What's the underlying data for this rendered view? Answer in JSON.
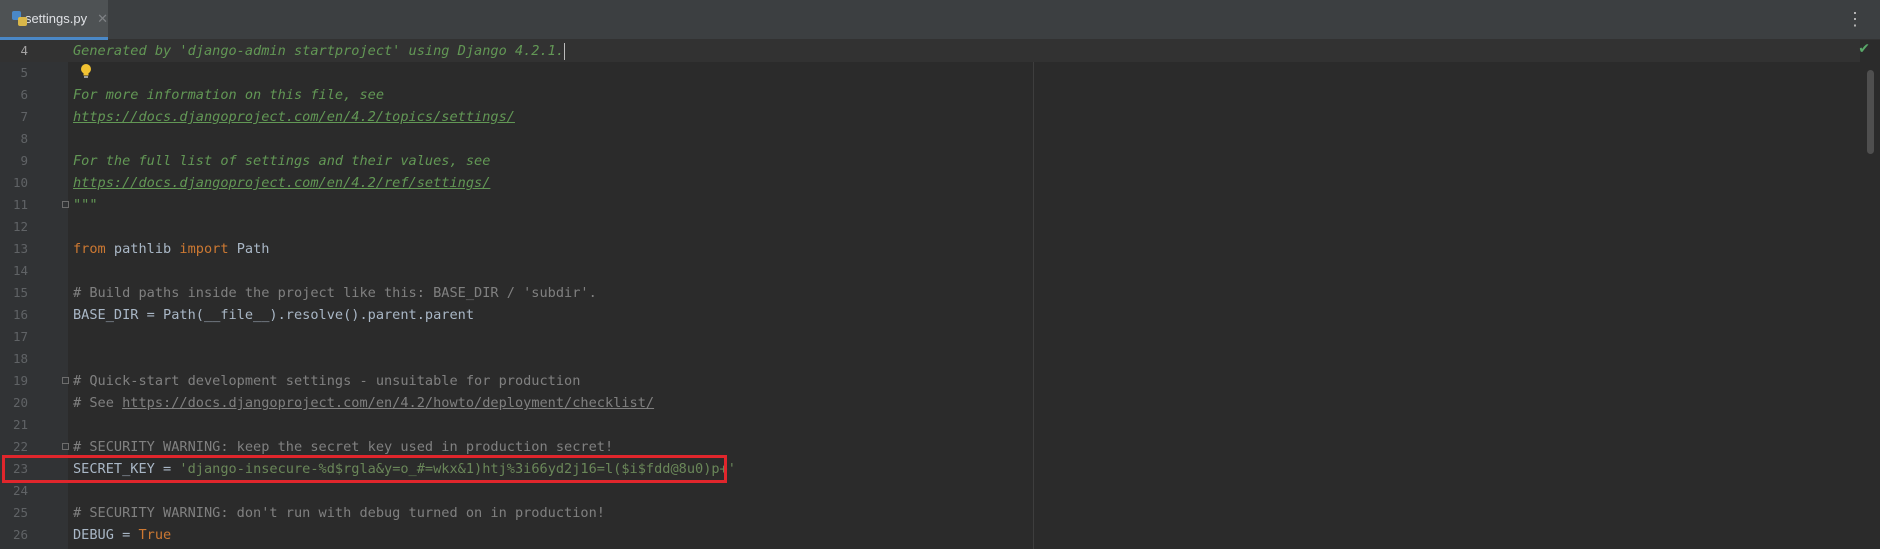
{
  "tab": {
    "filename": "settings.py",
    "close_glyph": "✕"
  },
  "menu_glyph": "⋮",
  "status": {
    "inspection_glyph": "✔"
  },
  "lines": [
    {
      "num": "4",
      "tokens": [
        {
          "t": "Generated by 'django-admin startproject' using Django 4.2.1.",
          "c": "doc"
        }
      ],
      "caret": true
    },
    {
      "num": "5",
      "tokens": []
    },
    {
      "num": "6",
      "tokens": [
        {
          "t": "For more information on this file, see",
          "c": "doc"
        }
      ]
    },
    {
      "num": "7",
      "tokens": [
        {
          "t": "https://docs.djangoproject.com/en/4.2/topics/settings/",
          "c": "doclink"
        }
      ]
    },
    {
      "num": "8",
      "tokens": []
    },
    {
      "num": "9",
      "tokens": [
        {
          "t": "For the full list of settings and their values, see",
          "c": "doc"
        }
      ]
    },
    {
      "num": "10",
      "tokens": [
        {
          "t": "https://docs.djangoproject.com/en/4.2/ref/settings/",
          "c": "doclink"
        }
      ]
    },
    {
      "num": "11",
      "tokens": [
        {
          "t": "\"\"\"",
          "c": "doc"
        }
      ]
    },
    {
      "num": "12",
      "tokens": []
    },
    {
      "num": "13",
      "tokens": [
        {
          "t": "from",
          "c": "kw"
        },
        {
          "t": " pathlib ",
          "c": "plain"
        },
        {
          "t": "import",
          "c": "kw"
        },
        {
          "t": " Path",
          "c": "plain"
        }
      ]
    },
    {
      "num": "14",
      "tokens": []
    },
    {
      "num": "15",
      "tokens": [
        {
          "t": "# Build paths inside the project like this: BASE_DIR / 'subdir'.",
          "c": "com"
        }
      ]
    },
    {
      "num": "16",
      "tokens": [
        {
          "t": "BASE_DIR = Path(__file__).resolve().parent.parent",
          "c": "plain"
        }
      ]
    },
    {
      "num": "17",
      "tokens": []
    },
    {
      "num": "18",
      "tokens": []
    },
    {
      "num": "19",
      "tokens": [
        {
          "t": "# Quick-start development settings - unsuitable for production",
          "c": "com"
        }
      ]
    },
    {
      "num": "20",
      "tokens": [
        {
          "t": "# See ",
          "c": "com"
        },
        {
          "t": "https://docs.djangoproject.com/en/4.2/howto/deployment/checklist/",
          "c": "comlink"
        }
      ]
    },
    {
      "num": "21",
      "tokens": []
    },
    {
      "num": "22",
      "tokens": [
        {
          "t": "# SECURITY WARNING: keep the secret key used in production secret!",
          "c": "com"
        }
      ]
    },
    {
      "num": "23",
      "tokens": [
        {
          "t": "SECRET_KEY = ",
          "c": "plain"
        },
        {
          "t": "'django-insecure-%d$rgla&y=o_#=wkx&1)htj%3i66yd2j16=l($i$fdd@8u0)p+'",
          "c": "str"
        }
      ]
    },
    {
      "num": "24",
      "tokens": []
    },
    {
      "num": "25",
      "tokens": [
        {
          "t": "# SECURITY WARNING: don't run with debug turned on in production!",
          "c": "com"
        }
      ]
    },
    {
      "num": "26",
      "tokens": [
        {
          "t": "DEBUG = ",
          "c": "plain"
        },
        {
          "t": "True",
          "c": "kw"
        }
      ]
    }
  ],
  "colors": {
    "background": "#2b2b2b",
    "docstring": "#629755",
    "keyword": "#cc7832",
    "comment": "#808080",
    "string": "#6a8759",
    "highlight_box": "#e0262c"
  }
}
